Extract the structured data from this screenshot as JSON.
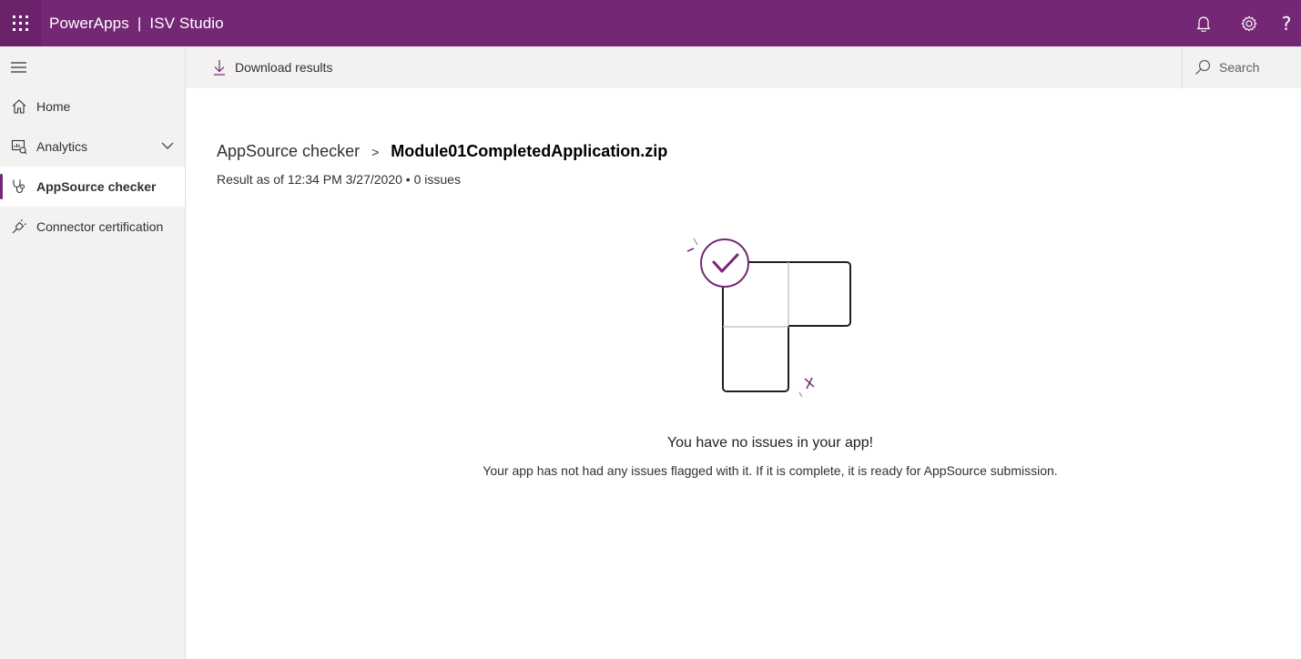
{
  "app": {
    "name": "PowerApps",
    "separator": "|",
    "studio": "ISV Studio"
  },
  "topbar": {
    "help_glyph": "?",
    "icons": [
      "waffle-icon",
      "bell-icon",
      "gear-icon",
      "help-icon"
    ],
    "color": "#742774"
  },
  "sidebar": {
    "items": [
      {
        "label": "Home",
        "icon": "home-icon",
        "active": false
      },
      {
        "label": "Analytics",
        "icon": "analytics-icon",
        "active": false,
        "expandable": true
      },
      {
        "label": "AppSource checker",
        "icon": "stethoscope-icon",
        "active": true
      },
      {
        "label": "Connector certification",
        "icon": "plug-icon",
        "active": false
      }
    ]
  },
  "commandbar": {
    "download_label": "Download results",
    "search_placeholder": "Search"
  },
  "main": {
    "breadcrumb": {
      "parent": "AppSource checker",
      "separator": ">",
      "current": "Module01CompletedApplication.zip"
    },
    "result_line": "Result as of 12:34 PM 3/27/2020 • 0 issues",
    "empty_state": {
      "title": "You have no issues in your app!",
      "description": "Your app has not had any issues flagged with it. If it is complete, it is ready for AppSource submission."
    }
  },
  "colors": {
    "accent": "#742774",
    "nav_background": "#f3f2f1"
  }
}
